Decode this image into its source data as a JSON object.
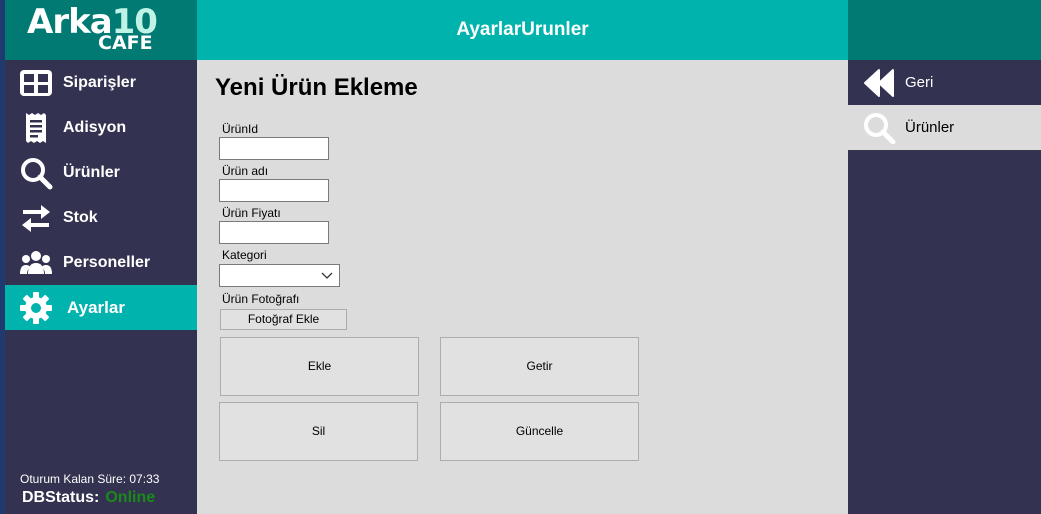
{
  "logo": {
    "line1_text": "Arka",
    "line1_num": "10",
    "line2": "CAFE"
  },
  "sidebar": {
    "items": [
      {
        "label": "Siparişler",
        "icon": "table-grid-icon"
      },
      {
        "label": "Adisyon",
        "icon": "receipt-icon"
      },
      {
        "label": "Ürünler",
        "icon": "search-icon"
      },
      {
        "label": "Stok",
        "icon": "swap-arrows-icon"
      },
      {
        "label": "Personeller",
        "icon": "users-icon"
      },
      {
        "label": "Ayarlar",
        "icon": "gear-icon",
        "active": true
      }
    ],
    "session_label": "Oturum Kalan Süre: 07:33",
    "db_label": "DBStatus:",
    "db_value": "Online"
  },
  "header": {
    "title": "AyarlarUrunler"
  },
  "form": {
    "heading": "Yeni Ürün Ekleme",
    "id_label": "ÜrünId",
    "id_value": "",
    "name_label": "Ürün adı",
    "name_value": "",
    "price_label": "Ürün Fiyatı",
    "price_value": "",
    "category_label": "Kategori",
    "category_value": "",
    "photo_label": "Ürün Fotoğrafı",
    "photo_button": "Fotoğraf Ekle",
    "add_button": "Ekle",
    "fetch_button": "Getir",
    "delete_button": "Sil",
    "update_button": "Güncelle"
  },
  "right_panel": {
    "back_label": "Geri",
    "urunler_label": "Ürünler"
  },
  "colors": {
    "teal_dark": "#007a73",
    "teal": "#00b3ad",
    "navy": "#333250",
    "content_bg": "#dcdcdc",
    "online_green": "#1a8a1a"
  }
}
